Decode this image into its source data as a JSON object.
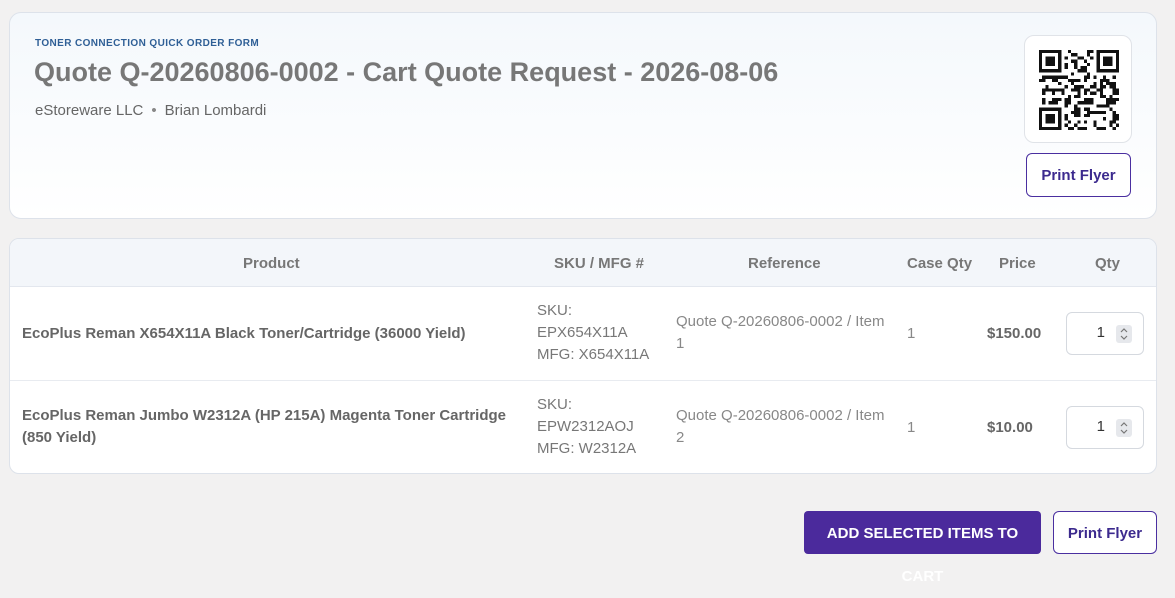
{
  "header": {
    "kicker": "TONER CONNECTION QUICK ORDER FORM",
    "title": "Quote Q-20260806-0002 - Cart Quote Request - 2026-08-06",
    "company": "eStoreware LLC",
    "separator": "•",
    "contact": "Brian Lombardi",
    "print_flyer_label": "Print Flyer"
  },
  "table": {
    "columns": [
      "Product",
      "SKU / MFG #",
      "Reference",
      "Case Qty",
      "Price",
      "Qty"
    ],
    "rows": [
      {
        "product": "EcoPlus Reman X654X11A Black Toner/Cartridge (36000 Yield)",
        "sku": "SKU: EPX654X11A",
        "mfg": "MFG: X654X11A",
        "reference": "Quote Q-20260806-0002 / Item 1",
        "case_qty": "1",
        "price": "$150.00",
        "qty": "1"
      },
      {
        "product": "EcoPlus Reman Jumbo W2312A (HP 215A) Magenta Toner Cartridge (850 Yield)",
        "sku": "SKU: EPW2312AOJ",
        "mfg": "MFG: W2312A",
        "reference": "Quote Q-20260806-0002 / Item 2",
        "case_qty": "1",
        "price": "$10.00",
        "qty": "1"
      }
    ]
  },
  "footer": {
    "add_to_cart_label": "ADD SELECTED ITEMS TO CART",
    "print_flyer_label": "Print Flyer"
  },
  "colors": {
    "primary": "#4b2a9c",
    "kicker": "#2f5f96",
    "page_bg": "#f2f1f1"
  },
  "icons": {
    "qr": "qr-code-icon",
    "spinner": "spinner-arrows-icon"
  }
}
